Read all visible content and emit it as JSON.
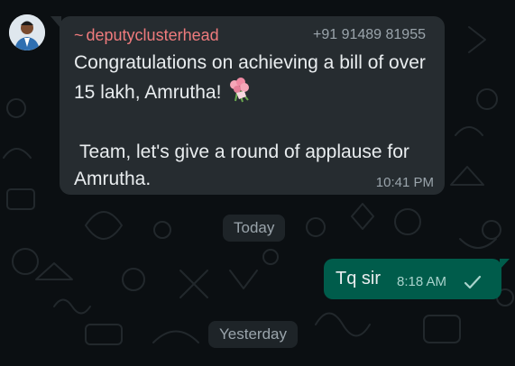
{
  "chat": {
    "incoming": {
      "sender_tilde": "~",
      "sender_name": "deputyclusterhead",
      "phone": "+91 91489 81955",
      "line1": "Congratulations on achieving a bill of over 15 lakh, Amrutha!",
      "line2": "Team, let's give a round of applause for Amrutha.",
      "time": "10:41 PM",
      "emoji_icon": "bouquet-icon"
    },
    "date_separators": [
      "Today",
      "Yesterday"
    ],
    "outgoing": {
      "text": "Tq sir",
      "time": "8:18 AM",
      "status_icon": "single-tick-icon"
    }
  },
  "colors": {
    "background": "#0b0f12",
    "incoming_bubble": "#262c30",
    "outgoing_bubble": "#005c4b",
    "sender_name": "#ef7b7d"
  }
}
